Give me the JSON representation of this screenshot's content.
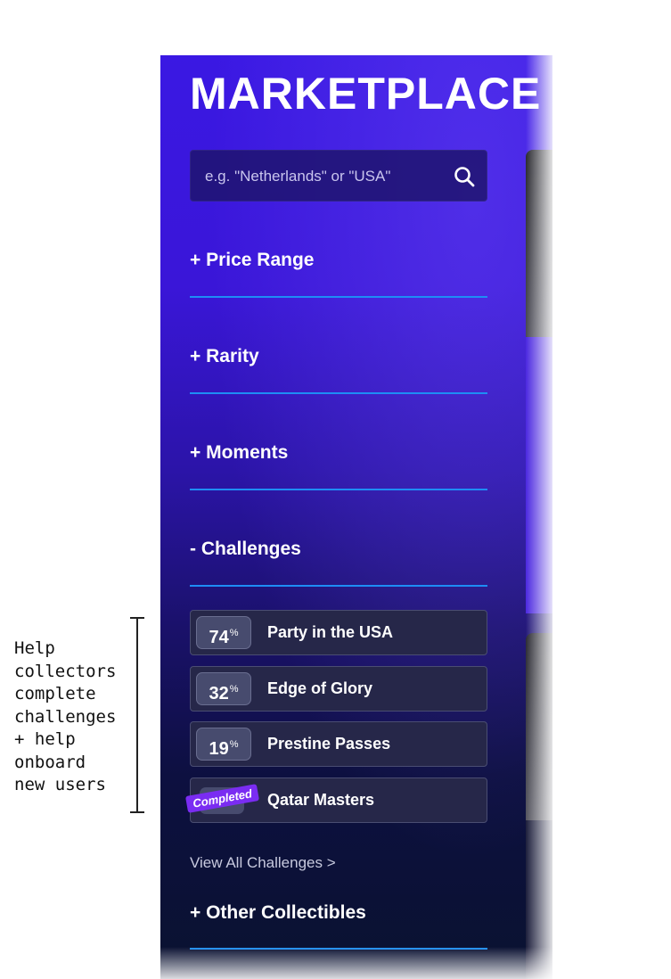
{
  "title": "MARKETPLACE",
  "search": {
    "placeholder": "e.g. \"Netherlands\" or \"USA\""
  },
  "filters": {
    "price_range": "+ Price Range",
    "rarity": "+ Rarity",
    "moments": "+ Moments",
    "challenges": "- Challenges",
    "other_collectibles": "+ Other Collectibles"
  },
  "challenges": [
    {
      "percent": "74",
      "name": "Party in the USA"
    },
    {
      "percent": "32",
      "name": "Edge of Glory"
    },
    {
      "percent": "19",
      "name": "Prestine Passes"
    },
    {
      "badge": "Completed",
      "name": "Qatar Masters"
    }
  ],
  "percent_sign": "%",
  "view_all": "View All Challenges >",
  "annotation": "Help\ncollectors\ncomplete\nchallenges\n+ help\nonboard\nnew users",
  "colors": {
    "accent_line": "#1e8df5",
    "badge": "#7a2cf2",
    "panel_top": "#3a18e3",
    "panel_bottom": "#0a1230"
  }
}
